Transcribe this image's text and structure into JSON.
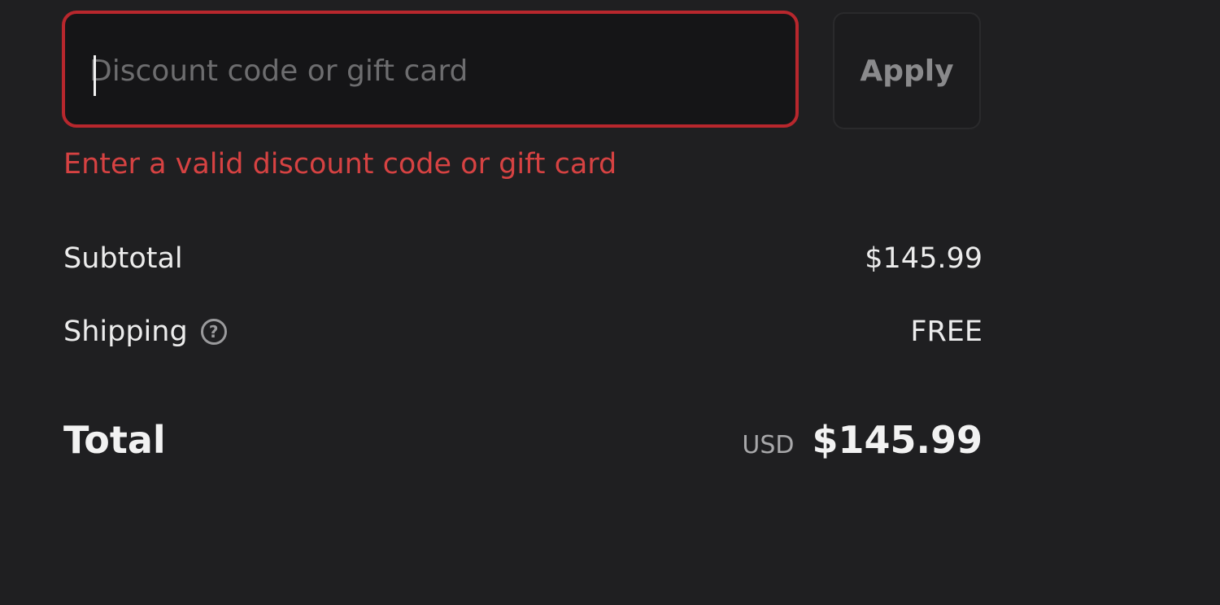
{
  "discount": {
    "placeholder": "Discount code or gift card",
    "value": "",
    "apply_label": "Apply",
    "error": "Enter a valid discount code or gift card"
  },
  "summary": {
    "subtotal_label": "Subtotal",
    "subtotal_value": "$145.99",
    "shipping_label": "Shipping",
    "shipping_help_glyph": "?",
    "shipping_value": "FREE",
    "total_label": "Total",
    "total_currency": "USD",
    "total_value": "$145.99"
  },
  "colors": {
    "background": "#1f1f21",
    "error_red": "#d64242",
    "input_error_border": "#b8272d"
  }
}
